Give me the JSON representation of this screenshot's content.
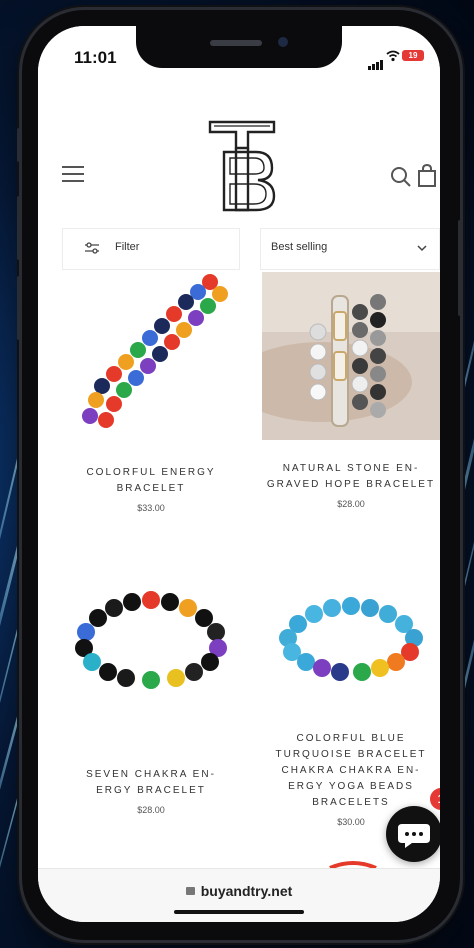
{
  "status_bar": {
    "time": "11:01",
    "battery": "19"
  },
  "header": {
    "menu_icon": "hamburger-icon",
    "logo_icon": "tb-monogram-logo",
    "search_icon": "search-icon",
    "cart_icon": "cart-icon"
  },
  "toolbar": {
    "filter_label": "Filter",
    "filter_icon": "sliders-icon",
    "sort_label": "Best selling",
    "sort_icon": "chevron-down-icon"
  },
  "products": [
    {
      "name": "COLORFUL ENERGY BRACELET",
      "price": "$33.00"
    },
    {
      "name": "NATURAL STONE EN-GRAVED HOPE BRACELET",
      "price": "$28.00"
    },
    {
      "name": "SEVEN CHAKRA EN-ERGY BRACELET",
      "price": "$28.00"
    },
    {
      "name": "COLORFUL BLUE TURQUOISE BRACELET CHAKRA CHAKRA EN-ERGY YOGA BEADS BRACELETS",
      "price": "$30.00"
    }
  ],
  "chat": {
    "icon": "chat-bubble-icon",
    "badge": "1"
  },
  "browser": {
    "url": "buyandtry.net",
    "lock_icon": "lock-icon"
  },
  "colors": {
    "accent": "#111111",
    "badge": "#e53935",
    "background": "#ffffff"
  }
}
